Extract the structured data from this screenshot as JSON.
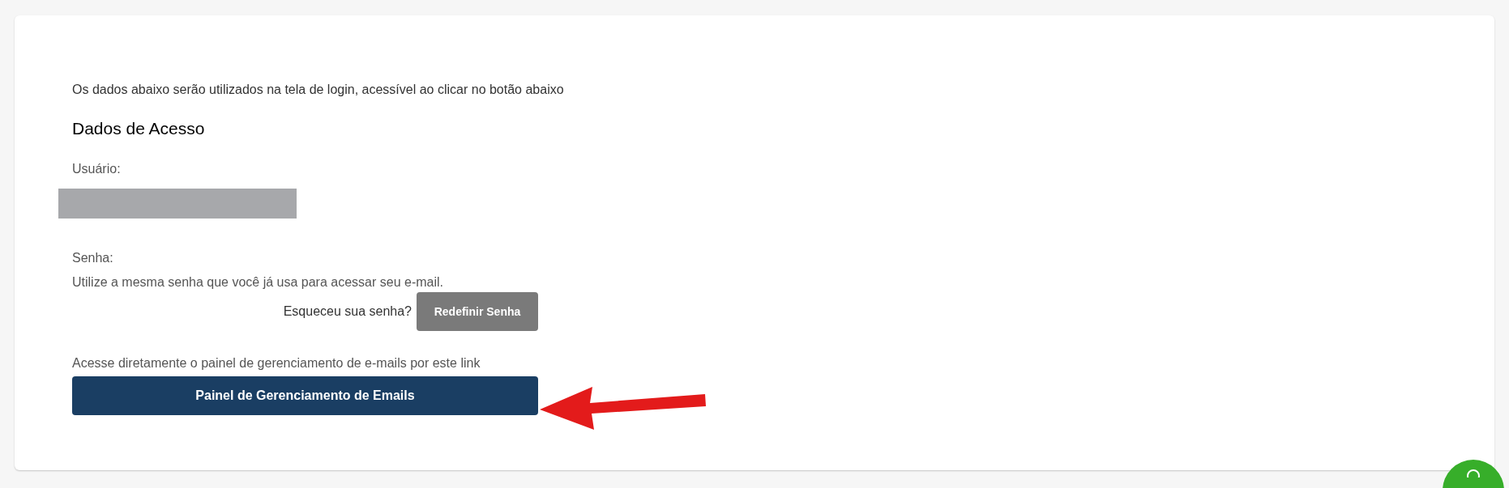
{
  "intro": "Os dados abaixo serão utilizados na tela de login, acessível ao clicar no botão abaixo",
  "heading": "Dados de Acesso",
  "user": {
    "label": "Usuário:"
  },
  "password": {
    "label": "Senha:",
    "hint": "Utilize a mesma senha que você já usa para acessar seu e-mail.",
    "forgot": "Esqueceu sua senha?",
    "reset_button": "Redefinir Senha"
  },
  "panel": {
    "text": "Acesse diretamente o painel de gerenciamento de e-mails por este link",
    "button": "Painel de Gerenciamento de Emails"
  }
}
